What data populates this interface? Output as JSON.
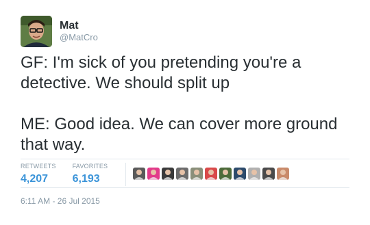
{
  "author": {
    "name": "Mat",
    "handle": "@MatCro"
  },
  "tweet": {
    "text": "GF: I'm sick of you pretending you're a detective. We should split up\n\nME: Good idea. We can cover more ground that way."
  },
  "stats": {
    "retweets_label": "RETWEETS",
    "retweets_value": "4,207",
    "favorites_label": "FAVORITES",
    "favorites_value": "6,193"
  },
  "favoriters": [
    {
      "icon": "user-avatar-icon",
      "color": "#5a5a5a"
    },
    {
      "icon": "user-avatar-icon",
      "color": "#e23a8a"
    },
    {
      "icon": "user-avatar-icon",
      "color": "#3a3a3a"
    },
    {
      "icon": "user-avatar-icon",
      "color": "#6c6c6c"
    },
    {
      "icon": "user-avatar-icon",
      "color": "#8a8f7a"
    },
    {
      "icon": "user-avatar-icon",
      "color": "#d94a4a"
    },
    {
      "icon": "user-avatar-icon",
      "color": "#4d6b3a"
    },
    {
      "icon": "user-avatar-icon",
      "color": "#2c4a6b"
    },
    {
      "icon": "user-avatar-icon",
      "color": "#b0b0b0"
    },
    {
      "icon": "user-avatar-icon",
      "color": "#4a4a4a"
    },
    {
      "icon": "user-avatar-icon",
      "color": "#c98a6a"
    }
  ],
  "timestamp": "6:11 AM - 26 Jul 2015",
  "colors": {
    "link_blue": "#3b94d9",
    "muted_gray": "#8899a6",
    "text_dark": "#292f33",
    "divider": "#e1e8ed"
  }
}
